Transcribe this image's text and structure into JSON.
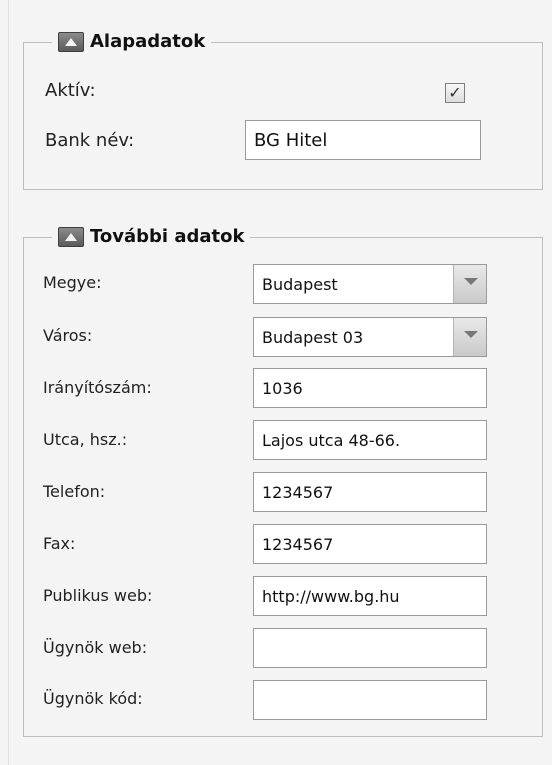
{
  "basic": {
    "title": "Alapadatok",
    "active_label": "Aktív:",
    "active_checked": true,
    "active_mark": "✓",
    "bank_name_label": "Bank név:",
    "bank_name_value": "BG Hitel"
  },
  "more": {
    "title": "További adatok",
    "county_label": "Megye:",
    "county_value": "Budapest",
    "city_label": "Város:",
    "city_value": "Budapest 03",
    "zip_label": "Irányítószám:",
    "zip_value": "1036",
    "street_label": "Utca, hsz.:",
    "street_value": "Lajos utca 48-66.",
    "phone_label": "Telefon:",
    "phone_value": "1234567",
    "fax_label": "Fax:",
    "fax_value": "1234567",
    "public_web_label": "Publikus web:",
    "public_web_value": "http://www.bg.hu",
    "agent_web_label": "Ügynök web:",
    "agent_web_value": "",
    "agent_code_label": "Ügynök kód:",
    "agent_code_value": ""
  },
  "icons": {
    "collapse": "collapse-up-icon",
    "dropdown": "chevron-down-icon"
  }
}
